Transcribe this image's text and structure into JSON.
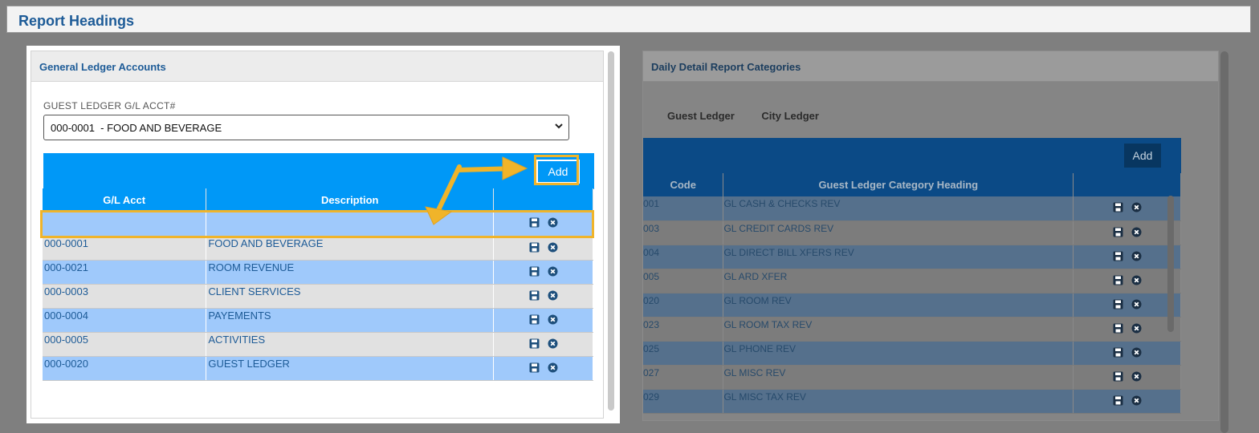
{
  "page": {
    "title": "Report Headings"
  },
  "left_panel": {
    "title": "General Ledger Accounts",
    "select_label": "GUEST LEDGER G/L ACCT#",
    "select_value": "000-0001  - FOOD AND BEVERAGE",
    "add_label": "Add",
    "columns": [
      "G/L Acct",
      "Description"
    ],
    "rows": [
      {
        "acct": "",
        "desc": ""
      },
      {
        "acct": "000-0001",
        "desc": "FOOD AND BEVERAGE"
      },
      {
        "acct": "000-0021",
        "desc": "ROOM REVENUE"
      },
      {
        "acct": "000-0003",
        "desc": "CLIENT SERVICES"
      },
      {
        "acct": "000-0004",
        "desc": "PAYEMENTS"
      },
      {
        "acct": "000-0005",
        "desc": "ACTIVITIES"
      },
      {
        "acct": "000-0020",
        "desc": "GUEST LEDGER"
      }
    ]
  },
  "right_panel": {
    "title": "Daily Detail Report Categories",
    "tabs": [
      "Guest Ledger",
      "City Ledger"
    ],
    "add_label": "Add",
    "columns": [
      "Code",
      "Guest Ledger Category Heading"
    ],
    "rows": [
      {
        "code": "001",
        "heading": "GL CASH & CHECKS REV"
      },
      {
        "code": "003",
        "heading": "GL CREDIT CARDS REV"
      },
      {
        "code": "004",
        "heading": "GL DIRECT BILL XFERS REV"
      },
      {
        "code": "005",
        "heading": "GL ARD XFER"
      },
      {
        "code": "020",
        "heading": "GL ROOM REV"
      },
      {
        "code": "023",
        "heading": "GL ROOM TAX REV"
      },
      {
        "code": "025",
        "heading": "GL PHONE REV"
      },
      {
        "code": "027",
        "heading": "GL MISC REV"
      },
      {
        "code": "029",
        "heading": "GL MISC TAX REV"
      }
    ]
  },
  "icons": {
    "save": "save-icon",
    "delete": "delete-icon"
  },
  "colors": {
    "accent": "#0098f7",
    "highlight": "#f0b42a",
    "alt_row": "#9fc9fb",
    "title": "#1d5b97"
  }
}
